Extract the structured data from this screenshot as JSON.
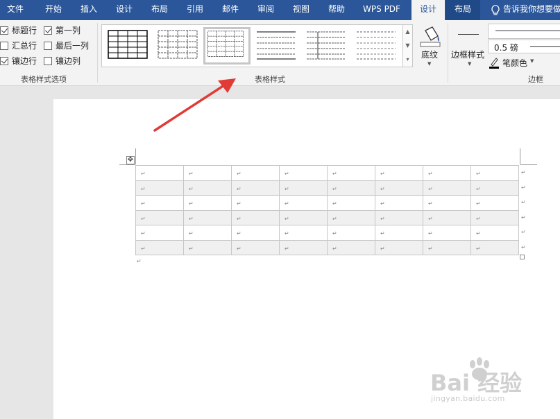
{
  "tabs": [
    {
      "label": "文件"
    },
    {
      "label": "开始"
    },
    {
      "label": "插入"
    },
    {
      "label": "设计"
    },
    {
      "label": "布局"
    },
    {
      "label": "引用"
    },
    {
      "label": "邮件"
    },
    {
      "label": "审阅"
    },
    {
      "label": "视图"
    },
    {
      "label": "帮助"
    },
    {
      "label": "WPS PDF"
    },
    {
      "label": "设计",
      "active": true
    },
    {
      "label": "布局",
      "context": true
    }
  ],
  "tell_me": {
    "text": "告诉我你想要做",
    "icon": "lightbulb-icon"
  },
  "style_options": {
    "group_label": "表格样式选项",
    "items": [
      {
        "label": "标题行",
        "checked": true
      },
      {
        "label": "第一列",
        "checked": true
      },
      {
        "label": "汇总行",
        "checked": false
      },
      {
        "label": "最后一列",
        "checked": false
      },
      {
        "label": "镶边行",
        "checked": true
      },
      {
        "label": "镶边列",
        "checked": false
      }
    ]
  },
  "table_styles": {
    "group_label": "表格样式",
    "shading_label": "底纹",
    "selected_index": 2,
    "scroll_icons": [
      "chevron-up-icon",
      "chevron-down-icon",
      "more-icon"
    ]
  },
  "borders": {
    "group_label": "边框",
    "border_styles_label": "边框样式",
    "weight": "0.5 磅",
    "pen_color_label": "笔颜色"
  },
  "document": {
    "rows": 6,
    "cols": 8,
    "paragraph_mark": "↵",
    "banded_rows": [
      1,
      3,
      5
    ]
  },
  "watermark": {
    "text": "Bai 经验",
    "subtext": "jingyan.baidu.com"
  },
  "colors": {
    "ribbon_blue": "#2b579a",
    "arrow_red": "#e03b36"
  }
}
